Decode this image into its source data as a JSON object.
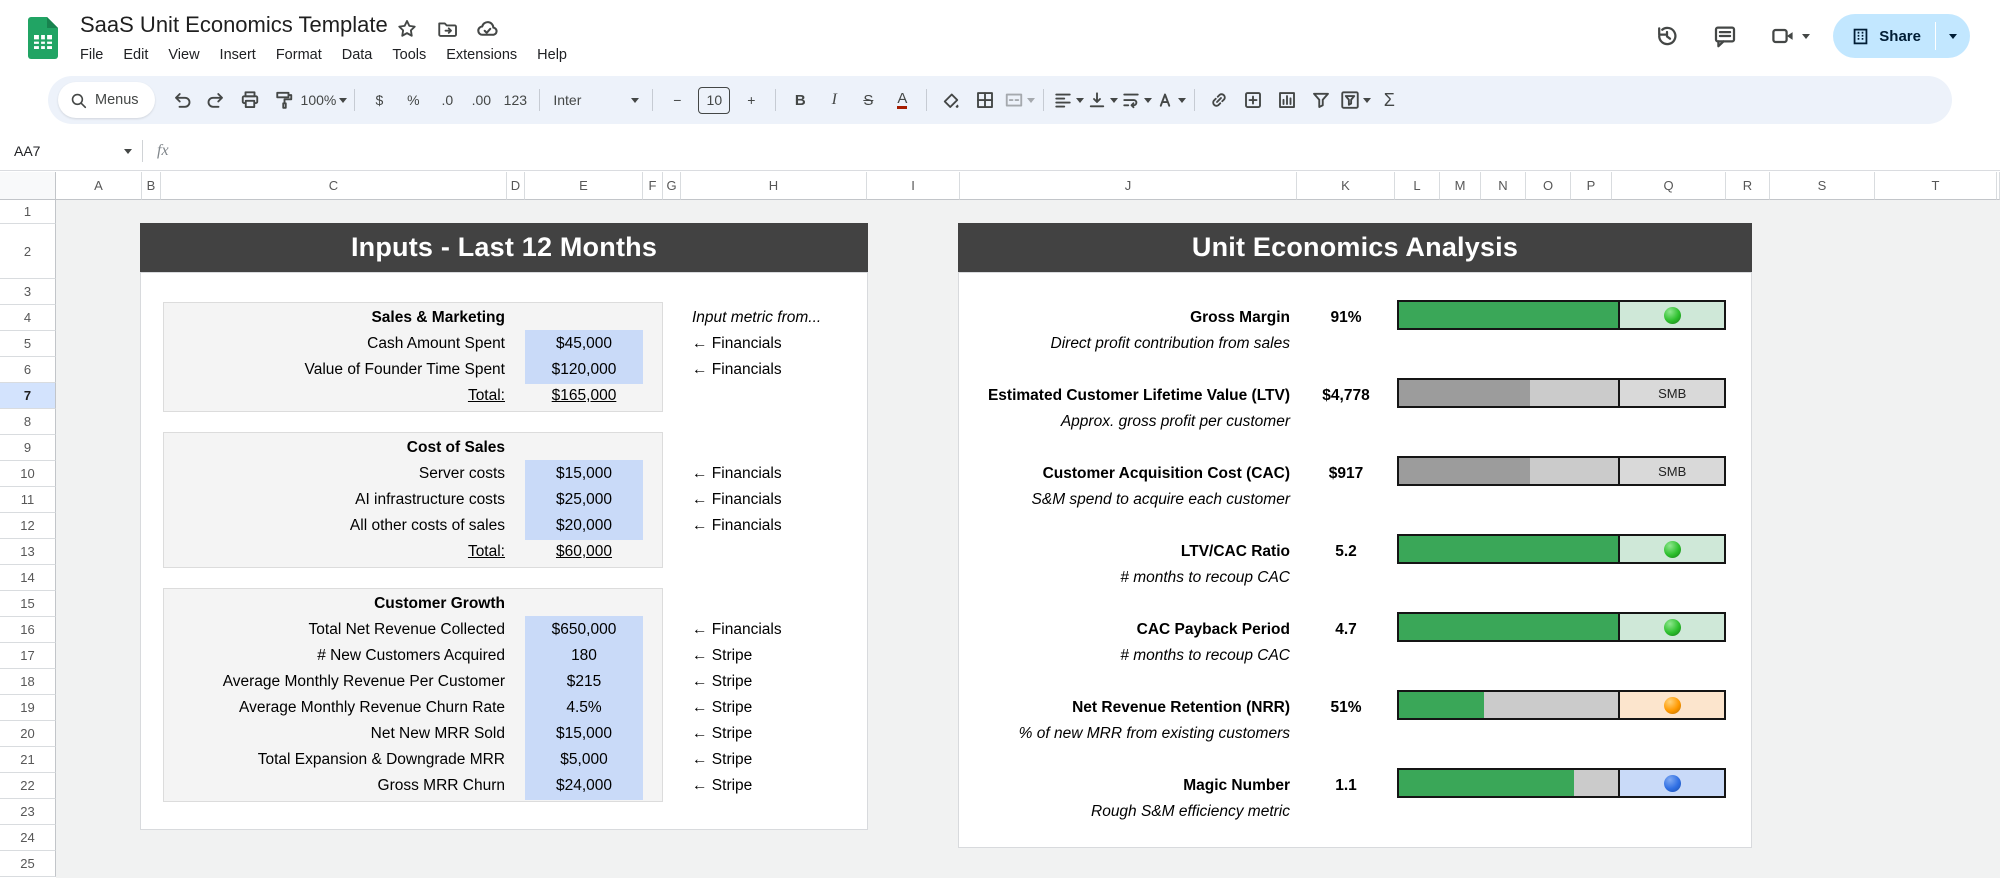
{
  "titlebar": {
    "title": "SaaS Unit Economics Template",
    "menus": [
      "File",
      "Edit",
      "View",
      "Insert",
      "Format",
      "Data",
      "Tools",
      "Extensions",
      "Help"
    ],
    "share_label": "Share"
  },
  "toolbar": {
    "menus_label": "Menus",
    "zoom_level": "100%",
    "currency": "$",
    "percent": "%",
    "decrease_decimal": ".0",
    "increase_decimal": ".00",
    "number_format": "123",
    "font_name": "Inter",
    "minus": "−",
    "font_size": "10",
    "plus": "+",
    "bold": "B",
    "italic": "I",
    "strikethrough": "S",
    "text_color": "A",
    "functions": "Σ"
  },
  "formula_bar": {
    "cell_ref": "AA7",
    "fx_label": "fx"
  },
  "grid": {
    "columns": [
      "A",
      "B",
      "C",
      "D",
      "E",
      "F",
      "G",
      "H",
      "I",
      "J",
      "K",
      "L",
      "M",
      "N",
      "O",
      "P",
      "Q",
      "R",
      "S",
      "T"
    ],
    "row_count": 25,
    "selected_row": "7"
  },
  "inputs_panel": {
    "title": "Inputs - Last 12 Months",
    "note": "Input metric from...",
    "sections": [
      {
        "title": "Sales & Marketing",
        "header_row": 4,
        "rows": [
          {
            "label": "Cash Amount Spent",
            "value": "$45,000",
            "source": "← Financials"
          },
          {
            "label": "Value of Founder Time Spent",
            "value": "$120,000",
            "source": "← Financials"
          }
        ],
        "total_label": "Total:",
        "total_value": "$165,000"
      },
      {
        "title": "Cost of Sales",
        "header_row": 9,
        "rows": [
          {
            "label": "Server costs",
            "value": "$15,000",
            "source": "← Financials"
          },
          {
            "label": "AI infrastructure costs",
            "value": "$25,000",
            "source": "← Financials"
          },
          {
            "label": "All other costs of sales",
            "value": "$20,000",
            "source": "← Financials"
          }
        ],
        "total_label": "Total:",
        "total_value": "$60,000"
      },
      {
        "title": "Customer Growth",
        "header_row": 15,
        "rows": [
          {
            "label": "Total Net Revenue Collected",
            "value": "$650,000",
            "source": "← Financials"
          },
          {
            "label": "# New Customers Acquired",
            "value": "180",
            "source": "← Stripe"
          },
          {
            "label": "Average Monthly Revenue Per Customer",
            "value": "$215",
            "source": "← Stripe"
          },
          {
            "label": "Average Monthly Revenue Churn Rate",
            "value": "4.5%",
            "source": "← Stripe"
          },
          {
            "label": "Net New MRR Sold",
            "value": "$15,000",
            "source": "← Stripe"
          },
          {
            "label": "Total Expansion & Downgrade MRR",
            "value": "$5,000",
            "source": "← Stripe"
          },
          {
            "label": "Gross MRR Churn",
            "value": "$24,000",
            "source": "← Stripe"
          }
        ]
      }
    ]
  },
  "analysis_panel": {
    "title": "Unit Economics Analysis",
    "metrics": [
      {
        "row": 4,
        "label": "Gross Margin",
        "value": "91%",
        "subtitle": "Direct profit contribution from sales",
        "bar": {
          "segments": [
            {
              "color": "#3aa758",
              "pct": 67.5
            }
          ],
          "zone": {
            "bg": "#cfe8d8",
            "dot": "green"
          }
        }
      },
      {
        "row": 7,
        "label": "Estimated Customer Lifetime Value (LTV)",
        "value": "$4,778",
        "subtitle": "Approx. gross profit per customer",
        "bar": {
          "segments": [
            {
              "color": "#9c9c9c",
              "pct": 40.2
            },
            {
              "color": "#cbcbcb",
              "pct": 27.3
            }
          ],
          "zone": {
            "bg": "#d9d9d9",
            "label": "SMB"
          }
        }
      },
      {
        "row": 10,
        "label": "Customer Acquisition Cost (CAC)",
        "value": "$917",
        "subtitle": "S&M spend to acquire each customer",
        "bar": {
          "segments": [
            {
              "color": "#9c9c9c",
              "pct": 40.2
            },
            {
              "color": "#cbcbcb",
              "pct": 27.3
            }
          ],
          "zone": {
            "bg": "#d9d9d9",
            "label": "SMB"
          }
        }
      },
      {
        "row": 13,
        "label": "LTV/CAC Ratio",
        "value": "5.2",
        "subtitle": "# months to recoup CAC",
        "bar": {
          "segments": [
            {
              "color": "#3aa758",
              "pct": 67.5
            }
          ],
          "zone": {
            "bg": "#cfe8d8",
            "dot": "green"
          }
        }
      },
      {
        "row": 16,
        "label": "CAC Payback Period",
        "value": "4.7",
        "subtitle": "# months to recoup CAC",
        "bar": {
          "segments": [
            {
              "color": "#3aa758",
              "pct": 67.5
            }
          ],
          "zone": {
            "bg": "#cfe8d8",
            "dot": "green"
          }
        }
      },
      {
        "row": 19,
        "label": "Net Revenue Retention (NRR)",
        "value": "51%",
        "subtitle": "% of new MRR from existing customers",
        "bar": {
          "segments": [
            {
              "color": "#3aa758",
              "pct": 26.2
            },
            {
              "color": "#cbcbcb",
              "pct": 41.3
            }
          ],
          "zone": {
            "bg": "#fce5cd",
            "dot": "orange"
          }
        }
      },
      {
        "row": 22,
        "label": "Magic Number",
        "value": "1.1",
        "subtitle": "Rough S&M efficiency metric",
        "bar": {
          "segments": [
            {
              "color": "#3aa758",
              "pct": 53.8
            },
            {
              "color": "#cbcbcb",
              "pct": 13.7
            }
          ],
          "zone": {
            "bg": "#c9daf8",
            "dot": "blue"
          }
        }
      }
    ]
  },
  "colors": {
    "band": "#424242",
    "canvas": "#f1f2f2",
    "input_cell": "#c9daf8",
    "bar_green": "#3aa758",
    "zone_green": "#cfe8d8",
    "zone_orange": "#fce5cd",
    "zone_blue": "#c9daf8",
    "zone_gray": "#d9d9d9",
    "share_pill": "#c2e7ff",
    "toolbar_bg": "#edf2fa",
    "selected_row_header": "#d3e3fd",
    "dots": {
      "green": {
        "hi": "#8fe78f",
        "main": "#2dc02d",
        "lo": "#157815"
      },
      "orange": {
        "hi": "#ffd27a",
        "main": "#ff9900",
        "lo": "#b36b00"
      },
      "blue": {
        "hi": "#7fa9f2",
        "main": "#2f6fe4",
        "lo": "#1d4ea8"
      }
    }
  }
}
